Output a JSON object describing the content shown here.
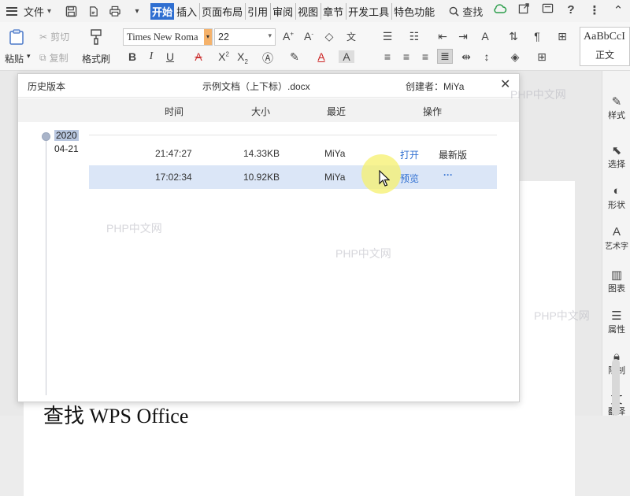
{
  "menubar": {
    "file_label": "文件",
    "tabs": [
      "开始",
      "插入",
      "页面布局",
      "引用",
      "审阅",
      "视图",
      "章节",
      "开发工具",
      "特色功能"
    ],
    "search_label": "查找"
  },
  "ribbon": {
    "paste": "粘贴",
    "cut": "剪切",
    "copy": "复制",
    "format_painter": "格式刷",
    "font_name": "Times New Roma",
    "font_size": "22",
    "style_preview": "AaBbCcI",
    "style_name": "正文"
  },
  "dialog": {
    "title_left": "历史版本",
    "filename": "示例文档（上下标）.docx",
    "author": "创建者：MiYa",
    "columns": {
      "time": "时间",
      "size": "大小",
      "recent": "最近",
      "actions": "操作"
    },
    "year": "2020",
    "date": "04-21",
    "rows": [
      {
        "time": "21:47:27",
        "size": "14.33KB",
        "user": "MiYa",
        "action": "打开",
        "status": "最新版"
      },
      {
        "time": "17:02:34",
        "size": "10.92KB",
        "user": "MiYa",
        "action": "预览",
        "more": "···"
      }
    ]
  },
  "sidebar": {
    "items": [
      "样式",
      "选择",
      "形状",
      "艺术字",
      "图表",
      "属性",
      "限制",
      "翻译"
    ]
  },
  "document": {
    "heading": "查找 WPS Office"
  },
  "watermarks": [
    "PHP中文网",
    "PHP中文网",
    "PHP中文网",
    "PHP中文网"
  ],
  "colors": {
    "accent": "#2f6fd1",
    "selected_row": "#dbe6f7"
  }
}
